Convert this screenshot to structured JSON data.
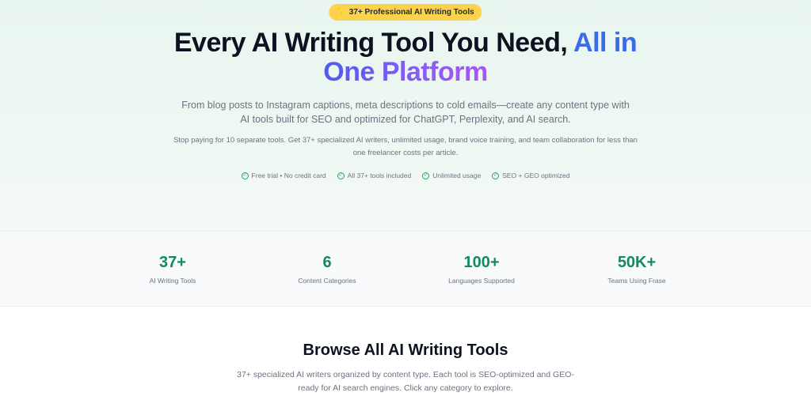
{
  "hero": {
    "badge": "37+ Professional AI Writing Tools",
    "headline_part1": "Every AI Writing Tool You Need, ",
    "headline_accent1": "All in",
    "headline_accent2": "One Platform",
    "subheadline": "From blog posts to Instagram captions, meta descriptions to cold emails—create any content type with AI tools built for SEO and optimized for ChatGPT, Perplexity, and AI search.",
    "description": "Stop paying for 10 separate tools. Get 37+ specialized AI writers, unlimited usage, brand voice training, and team collaboration for less than one freelancer costs per article.",
    "features": [
      "Free trial • No credit card",
      "All 37+ tools included",
      "Unlimited usage",
      "SEO + GEO optimized"
    ]
  },
  "stats": [
    {
      "value": "37+",
      "label": "AI Writing Tools"
    },
    {
      "value": "6",
      "label": "Content Categories"
    },
    {
      "value": "100+",
      "label": "Languages Supported"
    },
    {
      "value": "50K+",
      "label": "Teams Using Frase"
    }
  ],
  "browse": {
    "title": "Browse All AI Writing Tools",
    "subtitle": "37+ specialized AI writers organized by content type. Each tool is SEO-optimized and GEO-ready for AI search engines. Click any category to explore."
  },
  "colors": {
    "accent_green": "#138a5e",
    "accent_blue": "#3b6be8",
    "accent_purple": "#8b5cf6",
    "badge_yellow": "#fcd34d"
  }
}
